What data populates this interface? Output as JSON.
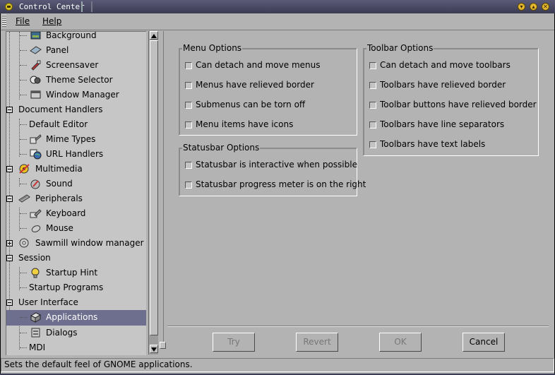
{
  "window": {
    "title": "Control Center",
    "buttons": [
      "minimize-icon",
      "maximize-icon",
      "close-icon"
    ]
  },
  "menubar": {
    "file": "File",
    "help": "Help"
  },
  "tree": {
    "items": [
      {
        "label": "Background",
        "icon": "background-icon"
      },
      {
        "label": "Panel",
        "icon": "panel-icon"
      },
      {
        "label": "Screensaver",
        "icon": "screensaver-icon"
      },
      {
        "label": "Theme Selector",
        "icon": "theme-selector-icon"
      },
      {
        "label": "Window Manager",
        "icon": "window-manager-icon"
      },
      {
        "label": "Document Handlers",
        "icon": ""
      },
      {
        "label": "Default Editor",
        "icon": ""
      },
      {
        "label": "Mime Types",
        "icon": "mime-types-icon"
      },
      {
        "label": "URL Handlers",
        "icon": "url-handlers-icon"
      },
      {
        "label": "Multimedia",
        "icon": "multimedia-icon"
      },
      {
        "label": "Sound",
        "icon": "sound-icon"
      },
      {
        "label": "Peripherals",
        "icon": "peripherals-icon"
      },
      {
        "label": "Keyboard",
        "icon": "keyboard-icon"
      },
      {
        "label": "Mouse",
        "icon": "mouse-icon"
      },
      {
        "label": "Sawmill window manager",
        "icon": "sawmill-icon"
      },
      {
        "label": "Session",
        "icon": ""
      },
      {
        "label": "Startup Hint",
        "icon": "startup-hint-icon"
      },
      {
        "label": "Startup Programs",
        "icon": ""
      },
      {
        "label": "User Interface",
        "icon": ""
      },
      {
        "label": "Applications",
        "icon": "applications-icon",
        "selected": true
      },
      {
        "label": "Dialogs",
        "icon": "dialogs-icon"
      },
      {
        "label": "MDI",
        "icon": ""
      }
    ]
  },
  "menu_options": {
    "title": "Menu Options",
    "options": [
      {
        "label": "Can detach and move menus",
        "checked": false
      },
      {
        "label": "Menus have relieved border",
        "checked": false
      },
      {
        "label": "Submenus can be torn off",
        "checked": false
      },
      {
        "label": "Menu items have icons",
        "checked": false
      }
    ]
  },
  "toolbar_options": {
    "title": "Toolbar Options",
    "options": [
      {
        "label": "Can detach and move toolbars",
        "checked": false
      },
      {
        "label": "Toolbars have relieved border",
        "checked": false
      },
      {
        "label": "Toolbar buttons have relieved border",
        "checked": false
      },
      {
        "label": "Toolbars have line separators",
        "checked": false
      },
      {
        "label": "Toolbars have text labels",
        "checked": false
      }
    ]
  },
  "statusbar_options": {
    "title": "Statusbar Options",
    "options": [
      {
        "label": "Statusbar is interactive when possible",
        "checked": false
      },
      {
        "label": "Statusbar progress meter is on the right",
        "checked": false
      }
    ]
  },
  "buttons": {
    "try": "Try",
    "revert": "Revert",
    "ok": "OK",
    "cancel": "Cancel"
  },
  "statusbar": {
    "text": "Sets the default feel of GNOME applications."
  }
}
